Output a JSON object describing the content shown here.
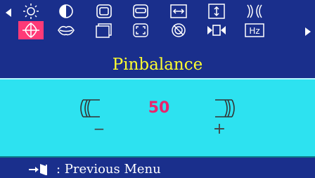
{
  "title": "Pinbalance",
  "value": "50",
  "minus_label": "−",
  "plus_label": "+",
  "footer": {
    "text": ": Previous Menu"
  },
  "colors": {
    "background": "#1a2f8c",
    "panel": "#2de2f0",
    "title": "#ffff2e",
    "value": "#e8246d",
    "selected": "#ff3a77"
  },
  "icons_row1": [
    "brightness-icon",
    "contrast-icon",
    "h-size-icon",
    "v-size-icon",
    "h-position-icon",
    "v-position-icon",
    "pincushion-icon"
  ],
  "icons_row2": [
    "pinbalance-icon",
    "parallelogram-icon",
    "rotation-icon",
    "zoom-icon",
    "degauss-icon",
    "reset-icon",
    "refresh-rate-icon"
  ],
  "refresh_label": "Hz",
  "selected_icon": "pinbalance-icon"
}
